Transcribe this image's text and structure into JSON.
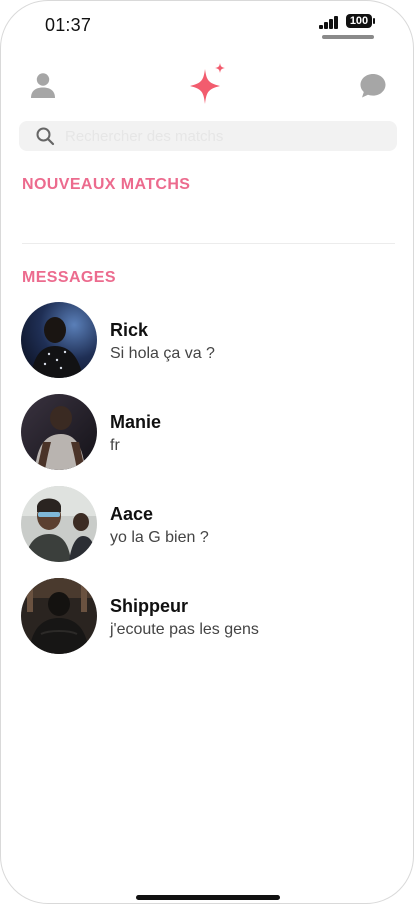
{
  "status_bar": {
    "time": "01:37",
    "battery": "100"
  },
  "header": {
    "profile_icon": "profile-icon",
    "logo_icon": "sparkle-logo-icon",
    "chat_icon": "chat-bubble-icon"
  },
  "search": {
    "placeholder": "Rechercher des matchs",
    "value": ""
  },
  "sections": {
    "new_matches": "NOUVEAUX MATCHS",
    "messages": "MESSAGES"
  },
  "colors": {
    "accent": "#ec6b8e",
    "logo": "#f25c6e"
  },
  "conversations": [
    {
      "name": "Rick",
      "preview": "Si hola ça va ?"
    },
    {
      "name": "Manie",
      "preview": "fr"
    },
    {
      "name": "Aace",
      "preview": "yo la G bien ?"
    },
    {
      "name": "Shippeur",
      "preview": "j'ecoute pas les gens"
    }
  ]
}
